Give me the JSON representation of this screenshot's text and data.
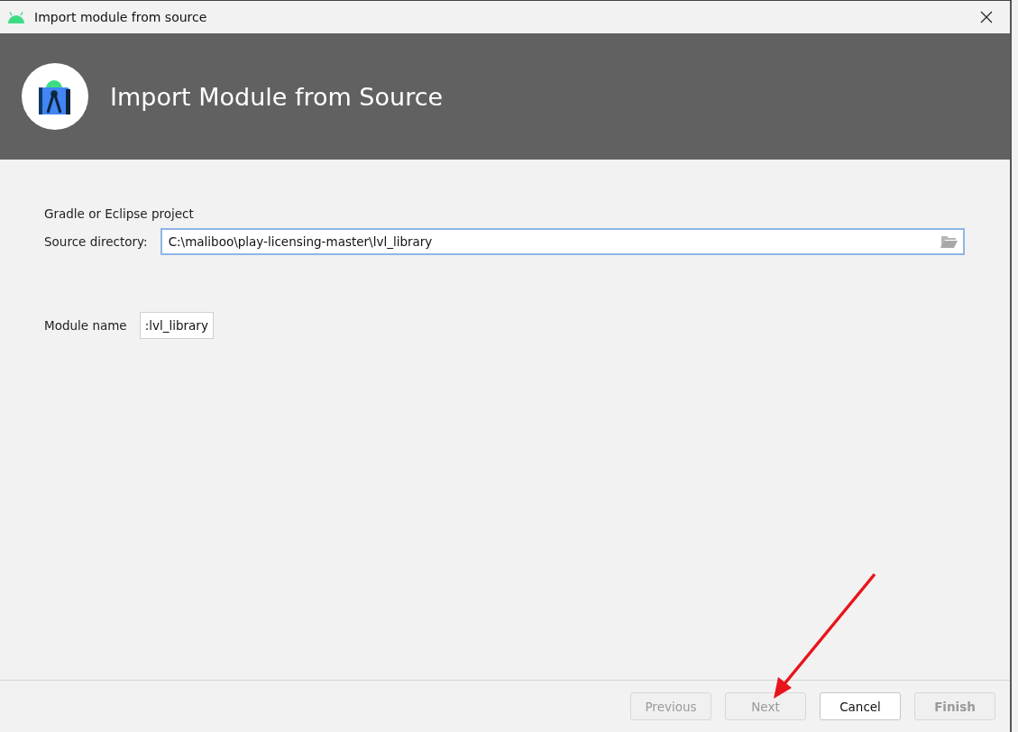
{
  "window": {
    "title": "Import module from source"
  },
  "header": {
    "title": "Import Module from Source"
  },
  "form": {
    "section_label": "Gradle or Eclipse project",
    "source_directory": {
      "label": "Source directory:",
      "value": "C:\\maliboo\\play-licensing-master\\lvl_library",
      "focused": true
    },
    "module_name": {
      "label": "Module name",
      "value": ":lvl_library"
    }
  },
  "buttons": [
    {
      "label": "Previous",
      "disabled": true,
      "default": false
    },
    {
      "label": "Next",
      "disabled": true,
      "default": false
    },
    {
      "label": "Cancel",
      "disabled": false,
      "default": false
    },
    {
      "label": "Finish",
      "disabled": true,
      "default": true
    }
  ]
}
